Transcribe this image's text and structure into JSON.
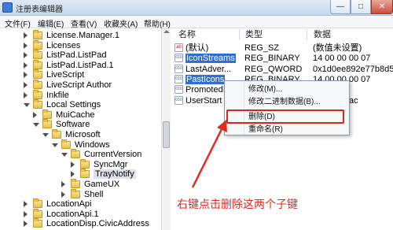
{
  "window": {
    "title": "注册表编辑器",
    "min_glyph": "—",
    "max_glyph": "□",
    "close_glyph": "✕"
  },
  "menu": [
    "文件(F)",
    "编辑(E)",
    "查看(V)",
    "收藏夹(A)",
    "帮助(H)"
  ],
  "tree": [
    {
      "label": "License.Manager.1",
      "expanded": false
    },
    {
      "label": "Licenses",
      "expanded": false
    },
    {
      "label": "ListPad.ListPad",
      "expanded": false
    },
    {
      "label": "ListPad.ListPad.1",
      "expanded": false
    },
    {
      "label": "LiveScript",
      "expanded": false
    },
    {
      "label": "LiveScript Author",
      "expanded": false
    },
    {
      "label": "Inkfile",
      "expanded": false
    },
    {
      "label": "Local Settings",
      "expanded": true
    },
    {
      "label": "MuiCache",
      "expanded": false
    },
    {
      "label": "Software",
      "expanded": true
    },
    {
      "label": "Microsoft",
      "expanded": true
    },
    {
      "label": "Windows",
      "expanded": true
    },
    {
      "label": "CurrentVersion",
      "expanded": true
    },
    {
      "label": "SyncMgr",
      "expanded": false
    },
    {
      "label": "TrayNotify",
      "expanded": false,
      "selected": true
    },
    {
      "label": "GameUX",
      "expanded": false
    },
    {
      "label": "Shell",
      "expanded": false
    },
    {
      "label": "LocationApi",
      "expanded": false
    },
    {
      "label": "LocationApi.1",
      "expanded": false
    },
    {
      "label": "LocationDisp.CivicAddress",
      "expanded": false
    }
  ],
  "columns": {
    "name": "名称",
    "type": "类型",
    "data": "数据"
  },
  "values": [
    {
      "icon": "ab",
      "name": "(默认)",
      "type": "REG_SZ",
      "data": "(数值未设置)",
      "selected": false
    },
    {
      "icon": "010",
      "name": "IconStreams",
      "type": "REG_BINARY",
      "data": "14 00 00 00 07",
      "selected": true
    },
    {
      "icon": "010",
      "name": "LastAdver...",
      "type": "REG_QWORD",
      "data": "0x1d0ee892e77b8d5",
      "selected": false
    },
    {
      "icon": "010",
      "name": "PastIcons",
      "type": "REG_BINARY",
      "data": "14 00 00 00 07",
      "selected": true
    },
    {
      "icon": "010",
      "name": "PromotedI",
      "type": "",
      "data": "76-37-42",
      "selected": false
    },
    {
      "icon": "010",
      "name": "UserStart",
      "type": "",
      "data": "ef343487ac",
      "selected": false
    }
  ],
  "context_menu": {
    "items": [
      {
        "label": "修改(M)..."
      },
      {
        "label": "修改二进制数据(B)..."
      },
      {
        "label": "删除(D)"
      },
      {
        "label": "重命名(R)"
      }
    ]
  },
  "annotation": {
    "text": "右键点击删除这两个子键",
    "color": "#e02a1f"
  }
}
